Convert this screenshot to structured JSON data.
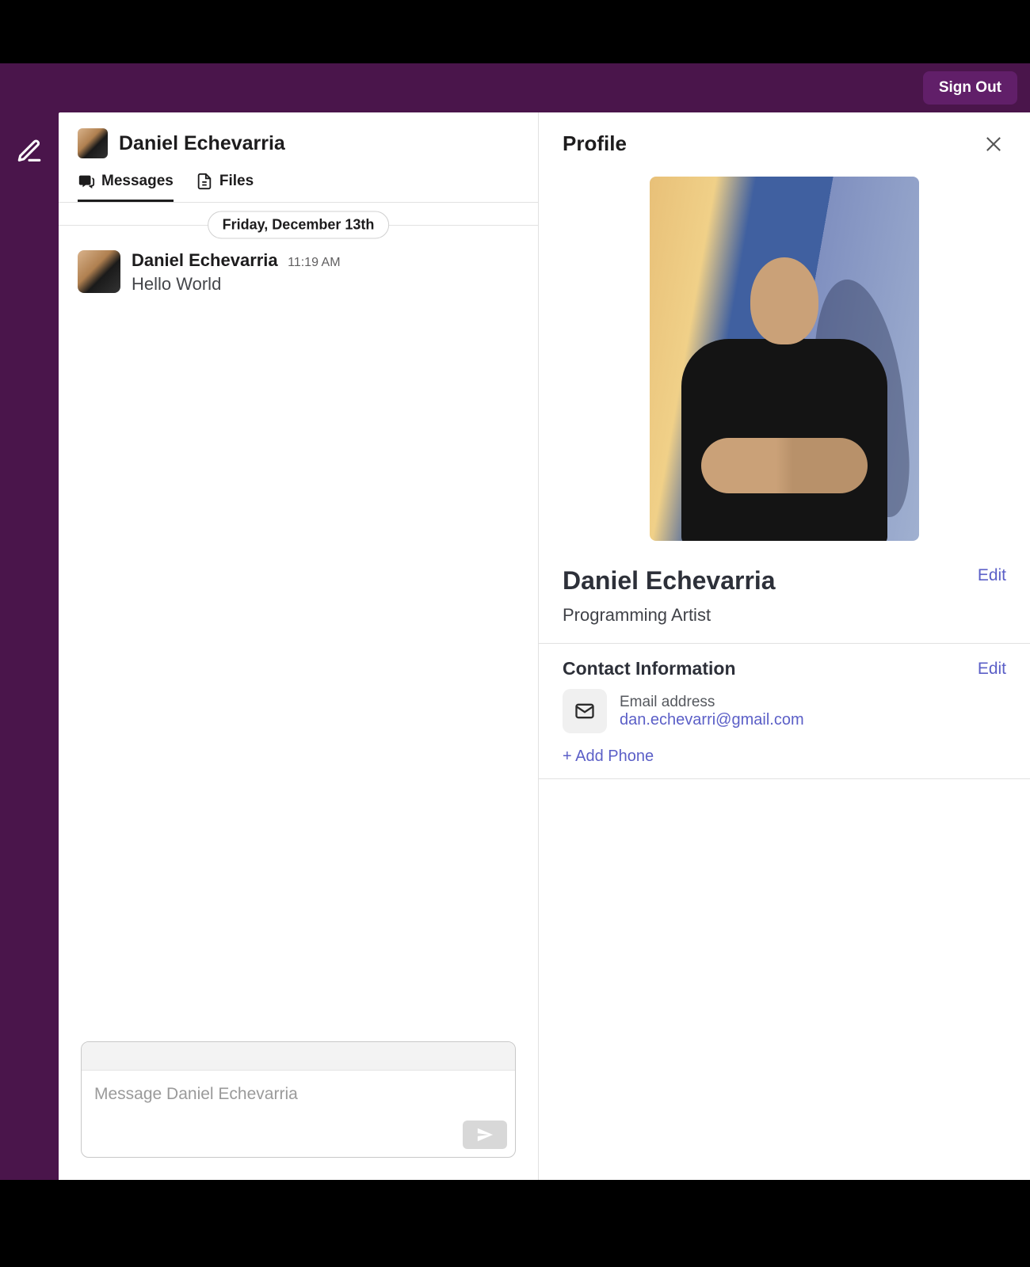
{
  "topbar": {
    "sign_out": "Sign Out"
  },
  "chat": {
    "title": "Daniel Echevarria",
    "tabs": {
      "messages": "Messages",
      "files": "Files"
    },
    "date_divider": "Friday, December 13th",
    "messages": [
      {
        "sender": "Daniel Echevarria",
        "time": "11:19 AM",
        "text": "Hello World"
      }
    ],
    "composer_placeholder": "Message Daniel Echevarria"
  },
  "profile": {
    "heading": "Profile",
    "name": "Daniel Echevarria",
    "title": "Programming Artist",
    "edit": "Edit",
    "contact_heading": "Contact Information",
    "email_label": "Email address",
    "email_value": "dan.echevarri@gmail.com",
    "add_phone": "+ Add Phone"
  }
}
